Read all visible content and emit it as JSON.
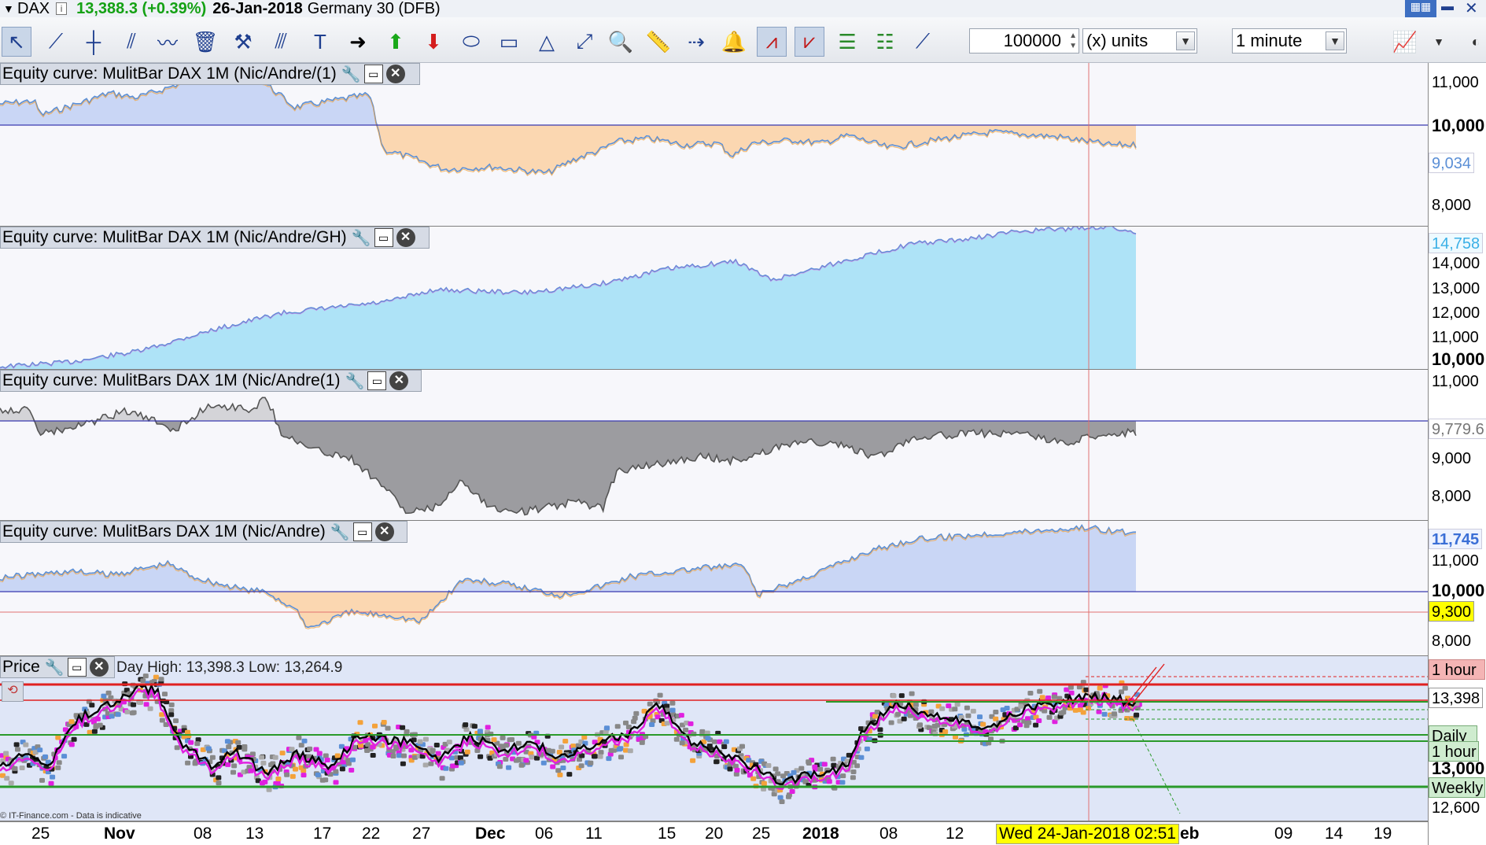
{
  "title_bar": {
    "symbol": "DAX",
    "price": "13,388.3 (+0.39%)",
    "date": "26-Jan-2018",
    "instrument": "Germany 30 (DFB)"
  },
  "toolbar": {
    "quantity": "100000",
    "units": "(x) units",
    "timeframe": "1 minute"
  },
  "panels": [
    {
      "title": "Equity curve: MulitBar DAX 1M (Nic/Andre/(1)"
    },
    {
      "title": "Equity curve: MulitBar DAX 1M (Nic/Andre/GH)"
    },
    {
      "title": "Equity curve: MulitBars DAX 1M (Nic/Andre(1)"
    },
    {
      "title": "Equity curve: MulitBars DAX 1M (Nic/Andre)"
    },
    {
      "title": "Price"
    }
  ],
  "price_info": {
    "strip": "Day High: 13,398.3   Low: 13,264.9",
    "footer": "© IT-Finance.com - Data is indicative"
  },
  "axis": {
    "panel1": [
      "11,000",
      "10,000",
      "8,000"
    ],
    "panel1_tag": "9,034",
    "panel2": [
      "14,000",
      "13,000",
      "12,000",
      "11,000",
      "10,000"
    ],
    "panel2_tag": "14,758",
    "panel3": [
      "11,000",
      "9,000",
      "8,000"
    ],
    "panel3_tag": "9,779.6",
    "panel4": [
      "11,000",
      "10,000",
      "8,000"
    ],
    "panel4_tag": "11,745",
    "panel4_marker": "9,300",
    "panel5": [
      "13,398",
      "13,000",
      "12,600"
    ],
    "panel5_tags": [
      "1 hour",
      "Daily",
      "1 hour",
      "Weekly"
    ]
  },
  "dates": [
    "25",
    "Nov",
    "08",
    "13",
    "17",
    "22",
    "27",
    "Dec",
    "06",
    "11",
    "15",
    "20",
    "25",
    "2018",
    "08",
    "12",
    "eb",
    "09",
    "14",
    "19"
  ],
  "cursor_date": "Wed 24-Jan-2018 02:51",
  "colors": {
    "price_up": "#14a114",
    "equity_orange": "#f4a23a",
    "equity_blue": "#5b8fd6",
    "equity_cyan": "#aee3f7",
    "equity_grey": "#9a9a9a",
    "ref_line": "#3a3ab0",
    "cursor_line": "#e07070"
  }
}
